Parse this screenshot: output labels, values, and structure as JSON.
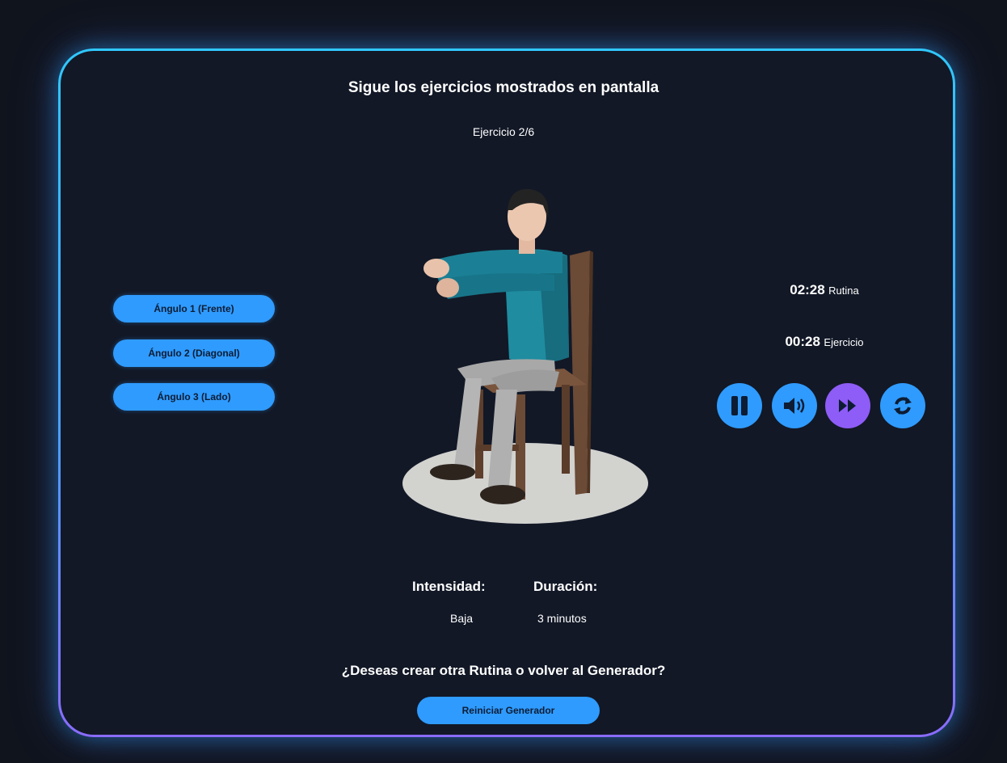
{
  "header": {
    "title": "Sigue los ejercicios mostrados en pantalla",
    "counter": "Ejercicio 2/6"
  },
  "angles": [
    {
      "label": "Ángulo 1 (Frente)"
    },
    {
      "label": "Ángulo 2 (Diagonal)"
    },
    {
      "label": "Ángulo 3 (Lado)"
    }
  ],
  "timers": {
    "routine_time": "02:28",
    "routine_label": "Rutina",
    "exercise_time": "00:28",
    "exercise_label": "Ejercicio"
  },
  "controls": [
    {
      "icon": "pause-icon",
      "color": "#2f9bff"
    },
    {
      "icon": "volume-icon",
      "color": "#2f9bff"
    },
    {
      "icon": "fast-forward-icon",
      "color": "#8e5cf7"
    },
    {
      "icon": "restart-icon",
      "color": "#2f9bff"
    }
  ],
  "info": {
    "intensity_label": "Intensidad:",
    "intensity_value": "Baja",
    "duration_label": "Duración:",
    "duration_value": "3 minutos"
  },
  "footer": {
    "question": "¿Deseas crear otra Rutina o volver al Generador?",
    "restart_label": "Reiniciar Generador"
  }
}
